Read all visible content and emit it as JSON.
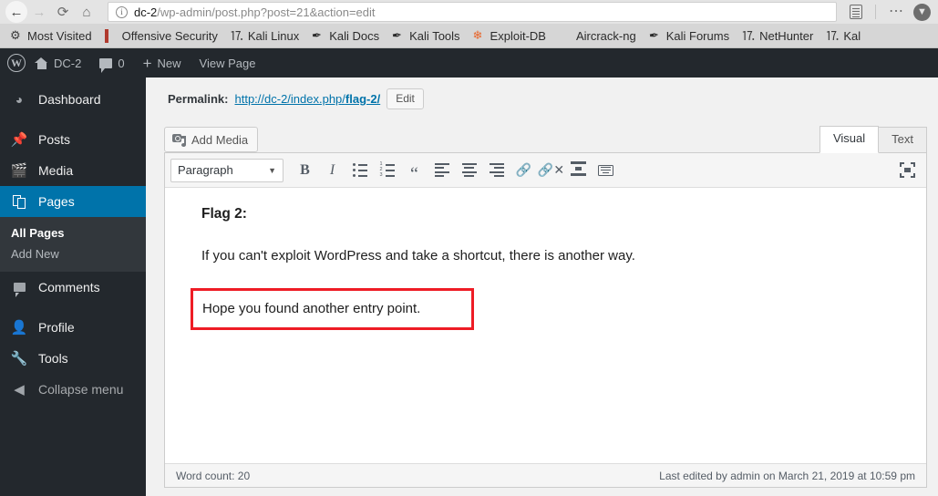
{
  "browser": {
    "nav": {
      "back": "back-arrow",
      "forward": "forward-arrow",
      "reload": "reload",
      "home": "home"
    },
    "url": {
      "host": "dc-2",
      "path": "/wp-admin/post.php?post=21&action=edit",
      "full": "dc-2/wp-admin/post.php?post=21&action=edit",
      "security_icon": "i"
    },
    "right_icons": [
      "reader-view",
      "page-actions",
      "save-to-pocket"
    ],
    "bookmarks": [
      {
        "label": "Most Visited",
        "icon": "gear"
      },
      {
        "label": "Offensive Security",
        "icon": "book"
      },
      {
        "label": "Kali Linux",
        "icon": "globe"
      },
      {
        "label": "Kali Docs",
        "icon": "wrench"
      },
      {
        "label": "Kali Tools",
        "icon": "wrench"
      },
      {
        "label": "Exploit-DB",
        "icon": "flame"
      },
      {
        "label": "Aircrack-ng",
        "icon": "card"
      },
      {
        "label": "Kali Forums",
        "icon": "wrench"
      },
      {
        "label": "NetHunter",
        "icon": "globe"
      },
      {
        "label": "Kal",
        "icon": "globe"
      }
    ]
  },
  "adminbar": {
    "logo": "W",
    "site_name": "DC-2",
    "comment_count": "0",
    "new_label": "New",
    "view_page_label": "View Page"
  },
  "sidebar": {
    "items": [
      {
        "label": "Dashboard",
        "icon": "dashboard-icon",
        "current": false
      },
      {
        "label": "Posts",
        "icon": "pin-icon",
        "current": false
      },
      {
        "label": "Media",
        "icon": "media-icon",
        "current": false
      },
      {
        "label": "Pages",
        "icon": "pages-icon",
        "current": true
      },
      {
        "label": "Comments",
        "icon": "comment-icon",
        "current": false
      },
      {
        "label": "Profile",
        "icon": "user-icon",
        "current": false
      },
      {
        "label": "Tools",
        "icon": "wrench-icon",
        "current": false
      },
      {
        "label": "Collapse menu",
        "icon": "collapse-icon",
        "current": false
      }
    ],
    "submenu": [
      {
        "label": "All Pages",
        "active": true
      },
      {
        "label": "Add New",
        "active": false
      }
    ],
    "accent_color": "#0073aa",
    "background_color": "#23282d"
  },
  "permalink": {
    "label": "Permalink:",
    "base": "http://dc-2/index.php/",
    "slug": "flag-2/",
    "edit_button": "Edit"
  },
  "editor": {
    "add_media_label": "Add Media",
    "tabs": [
      {
        "label": "Visual",
        "active": true
      },
      {
        "label": "Text",
        "active": false
      }
    ],
    "toolbar": {
      "format_select": "Paragraph",
      "buttons": [
        "bold",
        "italic",
        "bulleted-list",
        "numbered-list",
        "blockquote",
        "align-left",
        "align-center",
        "align-right",
        "insert-link",
        "remove-link",
        "insert-read-more",
        "toolbar-toggle"
      ],
      "fullscreen": "distraction-free-mode"
    },
    "content": {
      "heading": "Flag 2:",
      "paragraph_1": "If you can't exploit WordPress and take a shortcut, there is another way.",
      "paragraph_2": "Hope you found another entry point.",
      "highlight_color": "#ee1c25"
    },
    "footer": {
      "word_count": "Word count: 20",
      "last_edited": "Last edited by admin on March 21, 2019 at 10:59 pm"
    }
  }
}
